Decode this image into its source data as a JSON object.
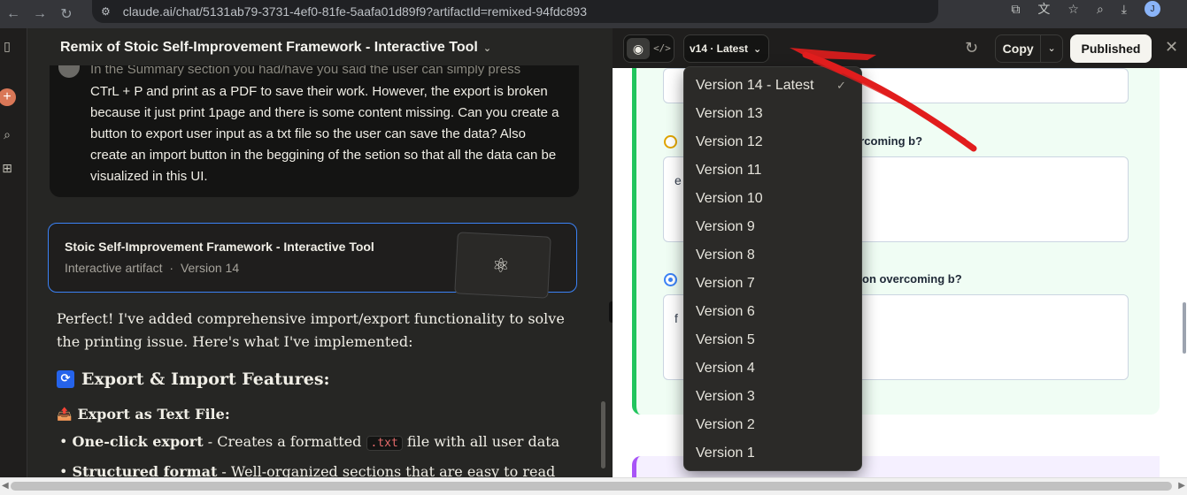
{
  "browser": {
    "url": "claude.ai/chat/5131ab79-3731-4ef0-81fe-5aafa01d89f9?artifactId=remixed-94fdc893",
    "profile_initial": "J"
  },
  "chat": {
    "title": "Remix of Stoic Self-Improvement Framework - Interactive Tool",
    "user_message_partial_top": "In the Summary section you had/have you said the user can simply press",
    "user_message": "CTrL + P and print as a PDF to save their work. However, the export is broken because it just print 1page and there is some content missing. Can you create a button to export user input as a txt file so the user can save the data? Also create an import button in the beggining of the setion so that all the data can be visualized in this UI.",
    "artifact_card": {
      "title": "Stoic Self-Improvement Framework - Interactive Tool",
      "type_label": "Interactive artifact",
      "separator": "·",
      "version_label": "Version 14"
    },
    "response": {
      "paragraph": "Perfect! I've added comprehensive import/export functionality to solve the printing issue. Here's what I've implemented:",
      "heading": "Export & Import Features:",
      "subheading": "Export as Text File:",
      "bullet1_bold": "One-click export",
      "bullet1_text_a": " - Creates a formatted ",
      "bullet1_code": ".txt",
      "bullet1_text_b": " file with all user data",
      "bullet2_bold": "Structured format",
      "bullet2_text": " - Well-organized sections that are easy to read"
    }
  },
  "artifact_toolbar": {
    "version_button": "v14 · Latest",
    "copy_label": "Copy",
    "published_label": "Published"
  },
  "artifact_content": {
    "question1_partial": "ercoming b?",
    "textarea1_partial": "e",
    "question2_partial": "on overcoming b?",
    "textarea2_partial": "f"
  },
  "version_menu": {
    "items": [
      "Version 14 - Latest",
      "Version 13",
      "Version 12",
      "Version 11",
      "Version 10",
      "Version 9",
      "Version 8",
      "Version 7",
      "Version 6",
      "Version 5",
      "Version 4",
      "Version 3",
      "Version 2",
      "Version 1"
    ],
    "selected_index": 0
  },
  "colors": {
    "accent_blue": "#3b82f6",
    "green": "#22c55e",
    "annotation_red": "#e11d1d",
    "claude_orange": "#d97757"
  }
}
